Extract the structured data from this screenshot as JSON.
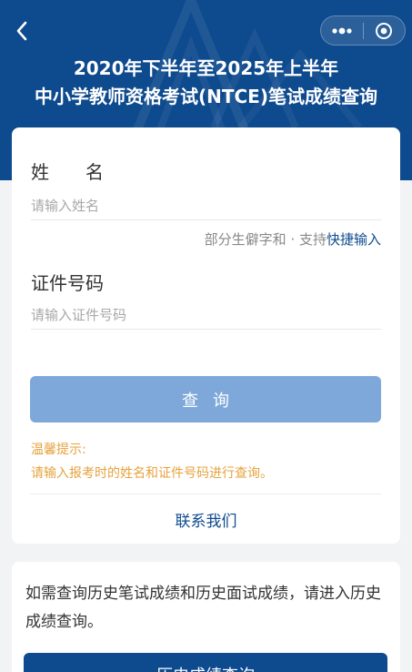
{
  "header": {
    "title_line1": "2020年下半年至2025年上半年",
    "title_line2": "中小学教师资格考试(NTCE)笔试成绩查询"
  },
  "nav": {
    "back_icon": "chevron-left-icon",
    "more_icon": "more-dots-icon",
    "close_icon": "target-circle-icon"
  },
  "form": {
    "name_label": "姓　　名",
    "name_placeholder": "请输入姓名",
    "hint_prefix": "部分生僻字和 · 支持",
    "hint_link": "快捷输入",
    "id_label": "证件号码",
    "id_placeholder": "请输入证件号码",
    "query_button": "查询",
    "tip_title": "温馨提示:",
    "tip_text": "请输入报考时的姓名和证件号码进行查询。",
    "contact": "联系我们"
  },
  "history": {
    "text": "如需查询历史笔试成绩和历史面试成绩，请进入历史成绩查询。",
    "button": "历史成绩查询"
  },
  "colors": {
    "brand": "#0e4a8e",
    "button_disabled": "#7ea8d9",
    "tip": "#e6a23c",
    "background": "#f2f3f5"
  }
}
